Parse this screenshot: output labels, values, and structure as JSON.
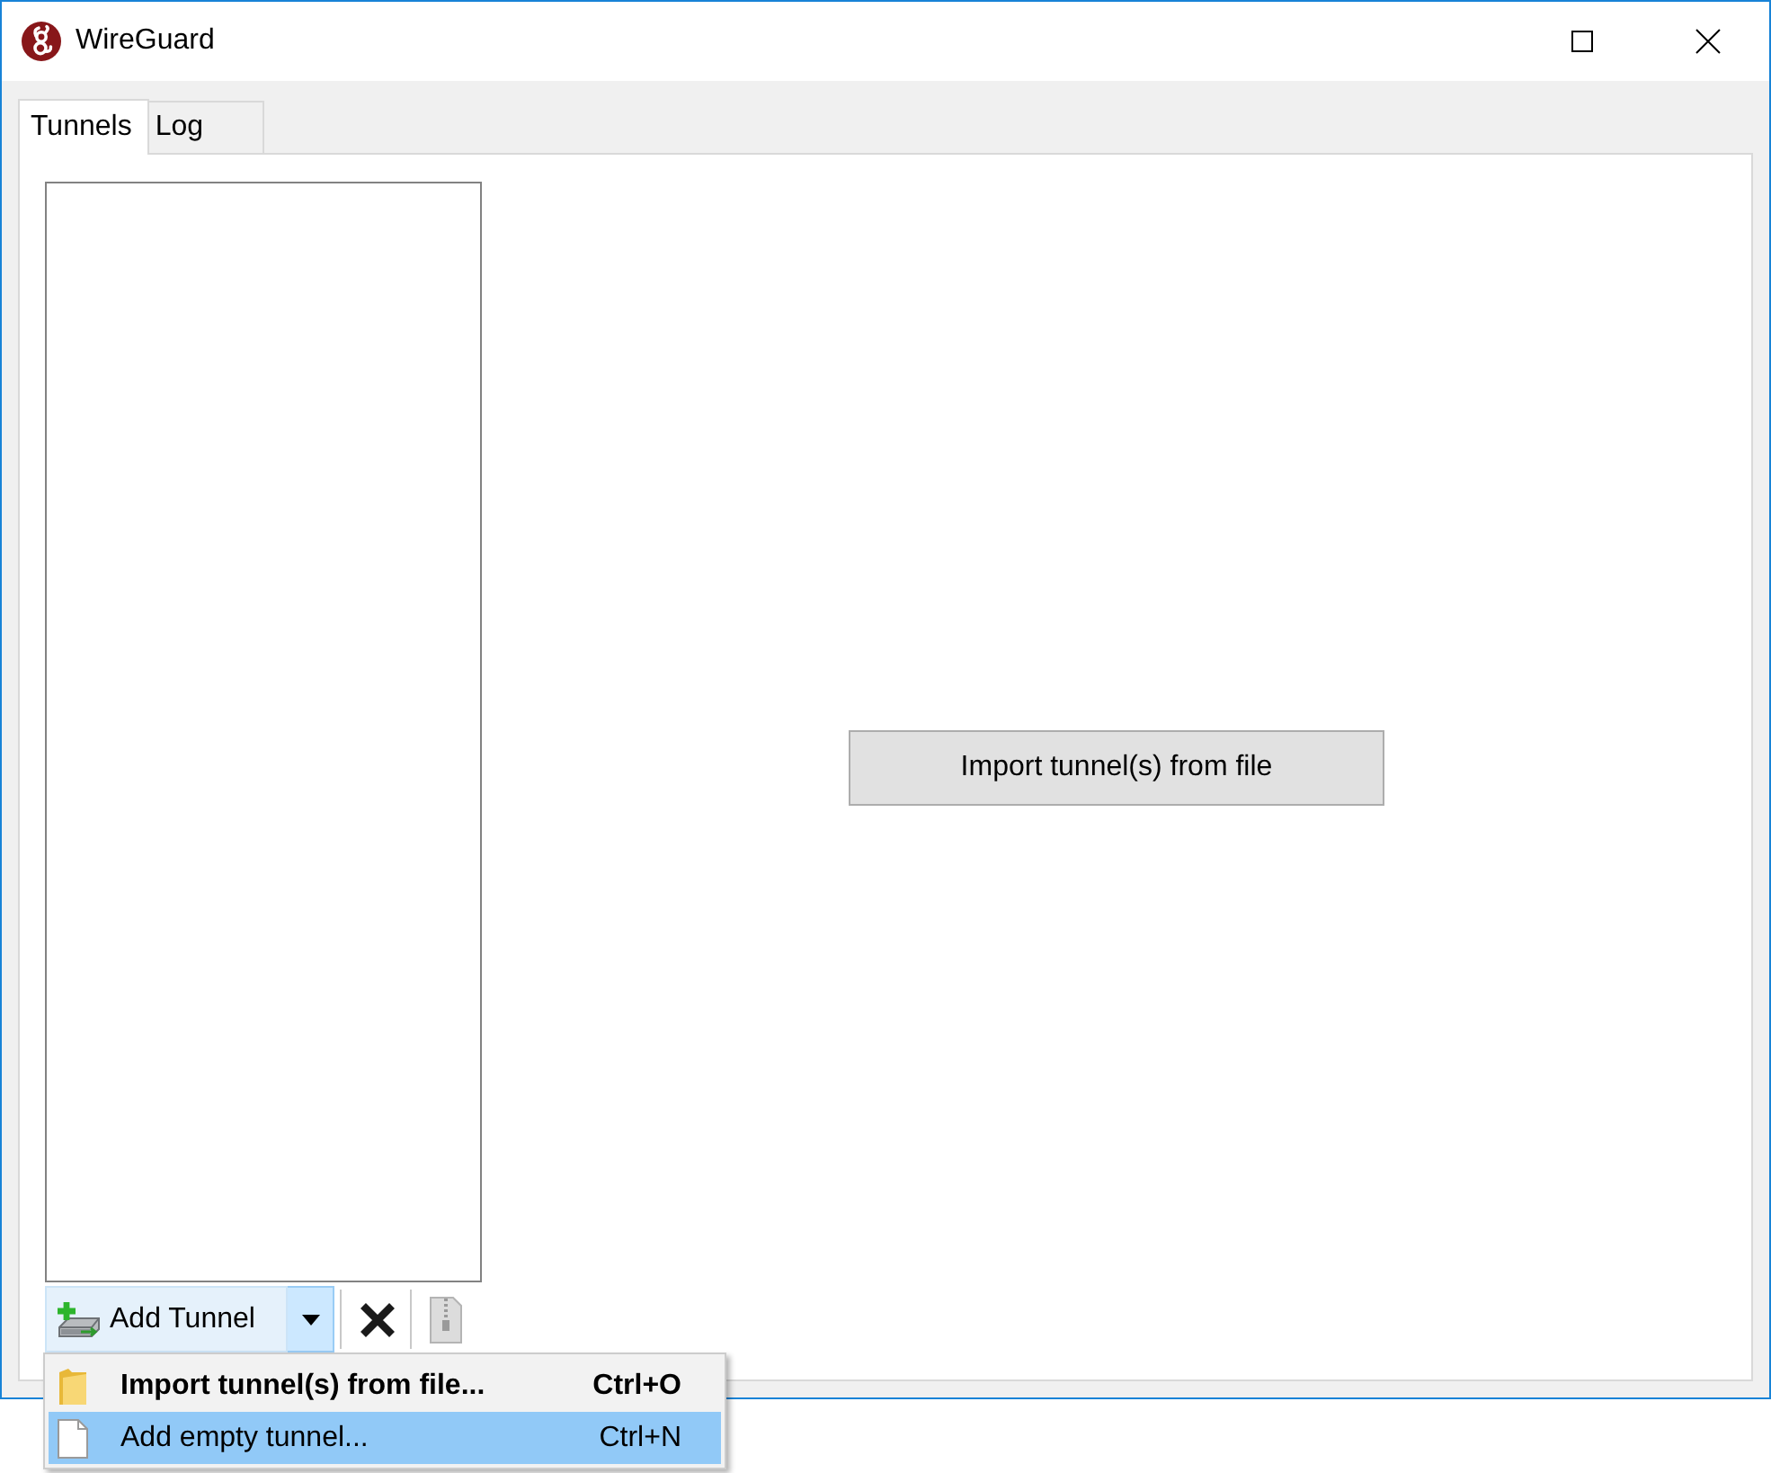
{
  "window": {
    "title": "WireGuard"
  },
  "tabs": [
    {
      "label": "Tunnels",
      "selected": true
    },
    {
      "label": "Log",
      "selected": false
    }
  ],
  "toolbar": {
    "add_tunnel": {
      "label": "Add Tunnel",
      "expanded": true
    },
    "tools": [
      {
        "kind": "delete",
        "disabled": false
      },
      {
        "kind": "export",
        "disabled": true
      }
    ]
  },
  "import_button": {
    "label": "Import tunnel(s) from file"
  },
  "menu": {
    "items": [
      {
        "kind": "import",
        "label": "Import tunnel(s) from file...",
        "shortcut": "Ctrl+O",
        "default": true,
        "selected": false
      },
      {
        "kind": "empty",
        "label": "Add empty tunnel...",
        "shortcut": "Ctrl+N",
        "default": false,
        "selected": true
      }
    ]
  }
}
